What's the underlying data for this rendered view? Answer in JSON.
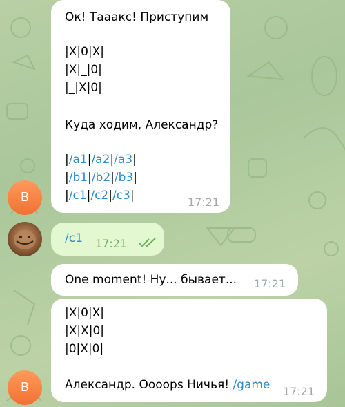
{
  "messages": [
    {
      "sender": "bot",
      "lines": [
        "Ок! Тааакс! Приступим",
        "",
        "|X|0|X|",
        "|X|_|0|",
        "|_|X|0|",
        "",
        "Куда ходим, Александр?",
        ""
      ],
      "commands": [
        [
          "/a1",
          "/a2",
          "/a3"
        ],
        [
          "/b1",
          "/b2",
          "/b3"
        ],
        [
          "/c1",
          "/c2",
          "/c3"
        ]
      ],
      "time": "17:21"
    },
    {
      "sender": "user",
      "text": "/c1",
      "time": "17:21",
      "status": "read-double-check"
    },
    {
      "sender": "bot",
      "text": "One moment! Ну... бывает...",
      "time": "17:21"
    },
    {
      "sender": "bot",
      "lines": [
        "|X|0|X|",
        "|X|X|0|",
        "|0|X|0|",
        ""
      ],
      "final_text": "Александр. Оooops Ничья! ",
      "final_link": "/game",
      "time": "17:21"
    }
  ],
  "avatars": {
    "bot_letter": "B",
    "bot_color": "#f07133",
    "user_photo": "user-photo"
  },
  "colors": {
    "incoming_bubble": "#ffffff",
    "outgoing_bubble": "#e3f7d1",
    "link": "#2f8ac6",
    "timestamp_in": "#a3a8ad",
    "timestamp_out": "#6fae5f"
  }
}
